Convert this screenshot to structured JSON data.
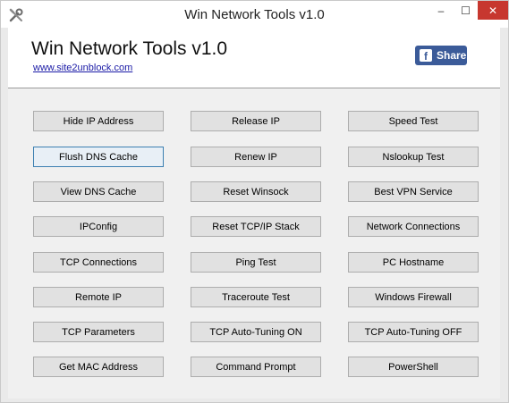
{
  "window": {
    "title": "Win Network Tools v1.0",
    "controls": {
      "minimize": "–",
      "maximize": "☐",
      "close": "✕"
    }
  },
  "header": {
    "app_title": "Win Network Tools v1.0",
    "website_link": "www.site2unblock.com",
    "share_label": "Share",
    "share_icon_glyph": "f"
  },
  "buttons": {
    "column1": [
      "Hide IP Address",
      "Flush DNS Cache",
      "View DNS Cache",
      "IPConfig",
      "TCP Connections",
      "Remote IP",
      "TCP Parameters",
      "Get MAC Address"
    ],
    "column2": [
      "Release IP",
      "Renew IP",
      "Reset Winsock",
      "Reset TCP/IP Stack",
      "Ping Test",
      "Traceroute Test",
      "TCP Auto-Tuning ON",
      "Command Prompt"
    ],
    "column3": [
      "Speed Test",
      "Nslookup Test",
      "Best VPN Service",
      "Network Connections",
      "PC Hostname",
      "Windows Firewall",
      "TCP Auto-Tuning OFF",
      "PowerShell"
    ]
  },
  "icons": {
    "app": "tools-icon",
    "share": "facebook-icon"
  },
  "colors": {
    "close_button": "#c7372f",
    "facebook_button": "#3b5b99",
    "link": "#1a1aa6",
    "focused_border": "#3c7fb1"
  }
}
